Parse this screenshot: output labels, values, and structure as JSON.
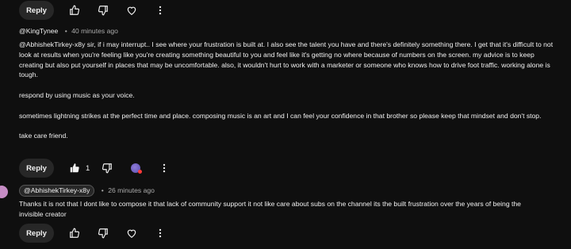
{
  "top_actions": {
    "reply_label": "Reply"
  },
  "comment1": {
    "author": "@KingTynee",
    "time": "40 minutes ago",
    "paragraphs": [
      "@AbhishekTirkey-x8y sir, if i may interrupt.. I see where your frustration is built at. I also see the talent you have and there's definitely something there. I get that it's difficult to not look at results when you're feeling like you're creating something beautiful to you and feel like it's getting no where because of numbers on the screen. my advice is to keep creating but also put yourself in places that may be uncomfortable. also, it wouldn't hurt to work with a marketer or someone who knows how to drive foot traffic. working alone is tough.",
      "respond by using music as your voice.",
      "sometimes lightning strikes at the perfect time and place. composing music is an art and I can feel your confidence in that brother so please keep that mindset and don't stop.",
      "take care friend."
    ],
    "reply_label": "Reply",
    "like_count": "1"
  },
  "comment2": {
    "author": "@AbhishekTirkey-x8y",
    "time": "26 minutes ago",
    "text": "Thanks it is not that I dont like to compose it that lack of community support it not like care about subs on the channel its the built frustration over the years of being the invisible creator",
    "reply_label": "Reply"
  }
}
